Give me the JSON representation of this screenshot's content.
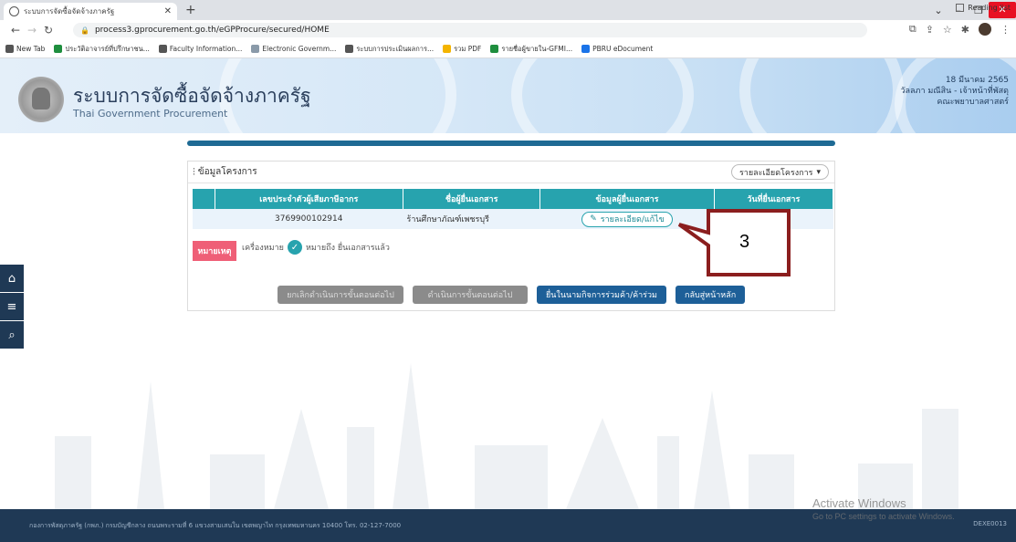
{
  "browser": {
    "tab_title": "ระบบการจัดซื้อจัดจ้างภาครัฐ",
    "new_tab": "+",
    "url": "process3.gprocurement.go.th/eGPProcure/secured/HOME",
    "bookmarks": [
      {
        "label": "New Tab",
        "color": "#555555"
      },
      {
        "label": "ประวัติอาจารย์ที่ปรึกษาชน...",
        "color": "#1e8e3e"
      },
      {
        "label": "Faculty Information...",
        "color": "#555555"
      },
      {
        "label": "Electronic Governm...",
        "color": "#8a9aa9"
      },
      {
        "label": "ระบบการประเมินผลการ...",
        "color": "#555555"
      },
      {
        "label": "รวม PDF",
        "color": "#f4b400"
      },
      {
        "label": "รายชื่อผู้ขายใน-GFMI...",
        "color": "#1e8e3e"
      },
      {
        "label": "PBRU eDocument",
        "color": "#1a73e8"
      }
    ],
    "reading_list": "Reading list"
  },
  "header": {
    "title": "ระบบการจัดซื้อจัดจ้างภาครัฐ",
    "subtitle": "Thai Government Procurement",
    "date": "18 มีนาคม 2565",
    "user": "วัลลภา มณีสิน - เจ้าหน้าที่พัสดุ",
    "dept": "คณะพยาบาลศาสตร์"
  },
  "panel": {
    "title": "ข้อมูลโครงการ",
    "detail_dropdown": "รายละเอียดโครงการ"
  },
  "table": {
    "headers": [
      "เลขประจำตัวผู้เสียภาษีอากร",
      "ชื่อผู้ยื่นเอกสาร",
      "ข้อมูลผู้ยื่นเอกสาร",
      "วันที่ยื่นเอกสาร"
    ],
    "rows": [
      {
        "tax_id": "3769900102914",
        "name": "ร้านศึกษาภัณฑ์เพชรบุรี",
        "action": "รายละเอียด/แก้ไข",
        "date": ""
      }
    ]
  },
  "legend": {
    "remark": "หมายเหตุ",
    "symbol_label": "เครื่องหมาย",
    "meaning": "หมายถึง ยื่นเอกสารแล้ว"
  },
  "actions": {
    "cancel_next": "ยกเลิกดำเนินการขั้นตอนต่อไป",
    "do_next": "ดำเนินการขั้นตอนต่อไป",
    "submit_joint": "ยื่นในนามกิจการร่วมค้า/ค้าร่วม",
    "back_home": "กลับสู่หน้าหลัก"
  },
  "callout": {
    "number": "3"
  },
  "footer": {
    "address": "กองการพัสดุภาครัฐ (กพภ.) กรมบัญชีกลาง ถนนพระรามที่ 6 แขวงสามเสนใน เขตพญาไท กรุงเทพมหานคร 10400 โทร. 02-127-7000",
    "code": "DEXE0013"
  },
  "watermark": {
    "line1": "Activate Windows",
    "line2": "Go to PC settings to activate Windows."
  },
  "colors": {
    "accent": "#27a3ae",
    "nav_dark": "#1f3955",
    "remark": "#ef5f77",
    "primary_button": "#1d5f98",
    "callout_border": "#8b1e1e"
  }
}
